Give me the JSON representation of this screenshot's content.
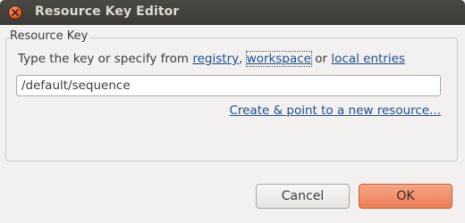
{
  "window": {
    "title": "Resource Key Editor"
  },
  "group": {
    "label": "Resource Key"
  },
  "prompt": {
    "text_before": "Type the key or specify from ",
    "link_registry": "registry",
    "sep1": ", ",
    "link_workspace": "workspace",
    "sep2": " or ",
    "link_local_entries": "local entries"
  },
  "key_field": {
    "value": "/default/sequence"
  },
  "create_link": {
    "label": "Create & point to a new resource..."
  },
  "buttons": {
    "cancel_label": "Cancel",
    "ok_label": "OK"
  },
  "colors": {
    "titlebar": "#3c3b37",
    "close_button": "#e0521e",
    "link": "#1e4e8c",
    "ok_button": "#ec7d55"
  },
  "icons": {
    "close": "close-icon"
  }
}
